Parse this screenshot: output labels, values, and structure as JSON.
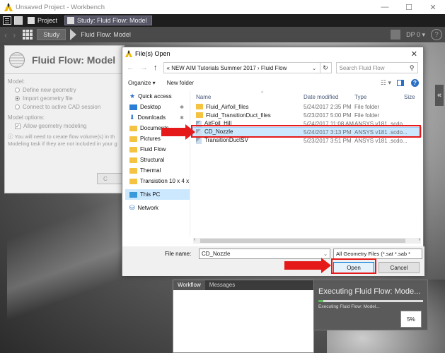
{
  "window": {
    "title": "Unsaved Project - Workbench",
    "controls": [
      "—",
      "☐",
      "✕"
    ]
  },
  "tabs": [
    {
      "label": "Project"
    },
    {
      "label": "Study: Fluid Flow: Model"
    }
  ],
  "nav": {
    "crumb_study": "Study",
    "crumb_current": "Fluid Flow: Model",
    "dp_label": "DP 0 ▾",
    "help_glyph": "?"
  },
  "task_panel": {
    "title": "Fluid Flow: Model",
    "model_label": "Model:",
    "options": [
      "Define new geometry",
      "Import geometry file",
      "Connect to active CAD session"
    ],
    "model_options_label": "Model options:",
    "allow_geometry": "Allow geometry modeling",
    "note_line1": "You will need to create flow volume(s) in th",
    "note_line2": "Modeling task if they are not included in your g",
    "button_partial": "C"
  },
  "dialog": {
    "title": "File(s) Open",
    "close": "✕",
    "address": {
      "prefix": "«",
      "part1": "NEW AIM Tutorials Summer 2017",
      "sep": "›",
      "part2": "Fluid Flow"
    },
    "search_placeholder": "Search Fluid Flow",
    "toolbar": {
      "organize": "Organize ▾",
      "new_folder": "New folder"
    },
    "nav_items": [
      {
        "label": "Quick access",
        "icon": "star-icon"
      },
      {
        "label": "Desktop",
        "icon": "desktop-icon",
        "pin": "✱"
      },
      {
        "label": "Downloads",
        "icon": "download-icon",
        "pin": "✱"
      },
      {
        "label": "Documents",
        "icon": "folder-icon"
      },
      {
        "label": "Pictures",
        "icon": "folder-icon"
      },
      {
        "label": "Fluid Flow",
        "icon": "folder-icon"
      },
      {
        "label": "Structural",
        "icon": "folder-icon"
      },
      {
        "label": "Thermal",
        "icon": "folder-icon"
      },
      {
        "label": "Transistion 10 x 4 x",
        "icon": "folder-icon"
      },
      {
        "label": "This PC",
        "icon": "pc-icon"
      },
      {
        "label": "Network",
        "icon": "network-icon"
      }
    ],
    "columns": {
      "name": "Name",
      "date": "Date modified",
      "type": "Type",
      "size": "Size"
    },
    "files": [
      {
        "name": "Fluid_Airfoil_files",
        "date": "5/24/2017 2:35 PM",
        "type": "File folder",
        "kind": "folder"
      },
      {
        "name": "Fluid_TransitionDuct_files",
        "date": "5/23/2017 5:00 PM",
        "type": "File folder",
        "kind": "folder"
      },
      {
        "name": "AirFoil_Hill",
        "date": "5/24/2017 11:08 AM",
        "type": "ANSYS v181 .scdo...",
        "kind": "file"
      },
      {
        "name": "CD_Nozzle",
        "date": "5/24/2017 3:13 PM",
        "type": "ANSYS v181 .scdo...",
        "kind": "file",
        "selected": true
      },
      {
        "name": "TransitionDuctSV",
        "date": "5/23/2017 3:51 PM",
        "type": "ANSYS v181 .scdo...",
        "kind": "file"
      }
    ],
    "file_name_label": "File name:",
    "file_name_value": "CD_Nozzle",
    "file_type_filter": "All Geometry Files (*.sat *.sab *",
    "open_label": "Open",
    "cancel_label": "Cancel"
  },
  "bottom": {
    "tab_workflow": "Workflow",
    "tab_messages": "Messages",
    "progress_title": "Executing Fluid Flow: Mode...",
    "progress_sub": "Executing Fluid Flow: Model...",
    "progress_fraction": 0.05,
    "progress_pct": "5%"
  },
  "colors": {
    "annotation_red": "#e51919",
    "selection_blue": "#cce8ff",
    "accent_blue": "#2a6fc6",
    "progress_green": "#5cb85c"
  }
}
